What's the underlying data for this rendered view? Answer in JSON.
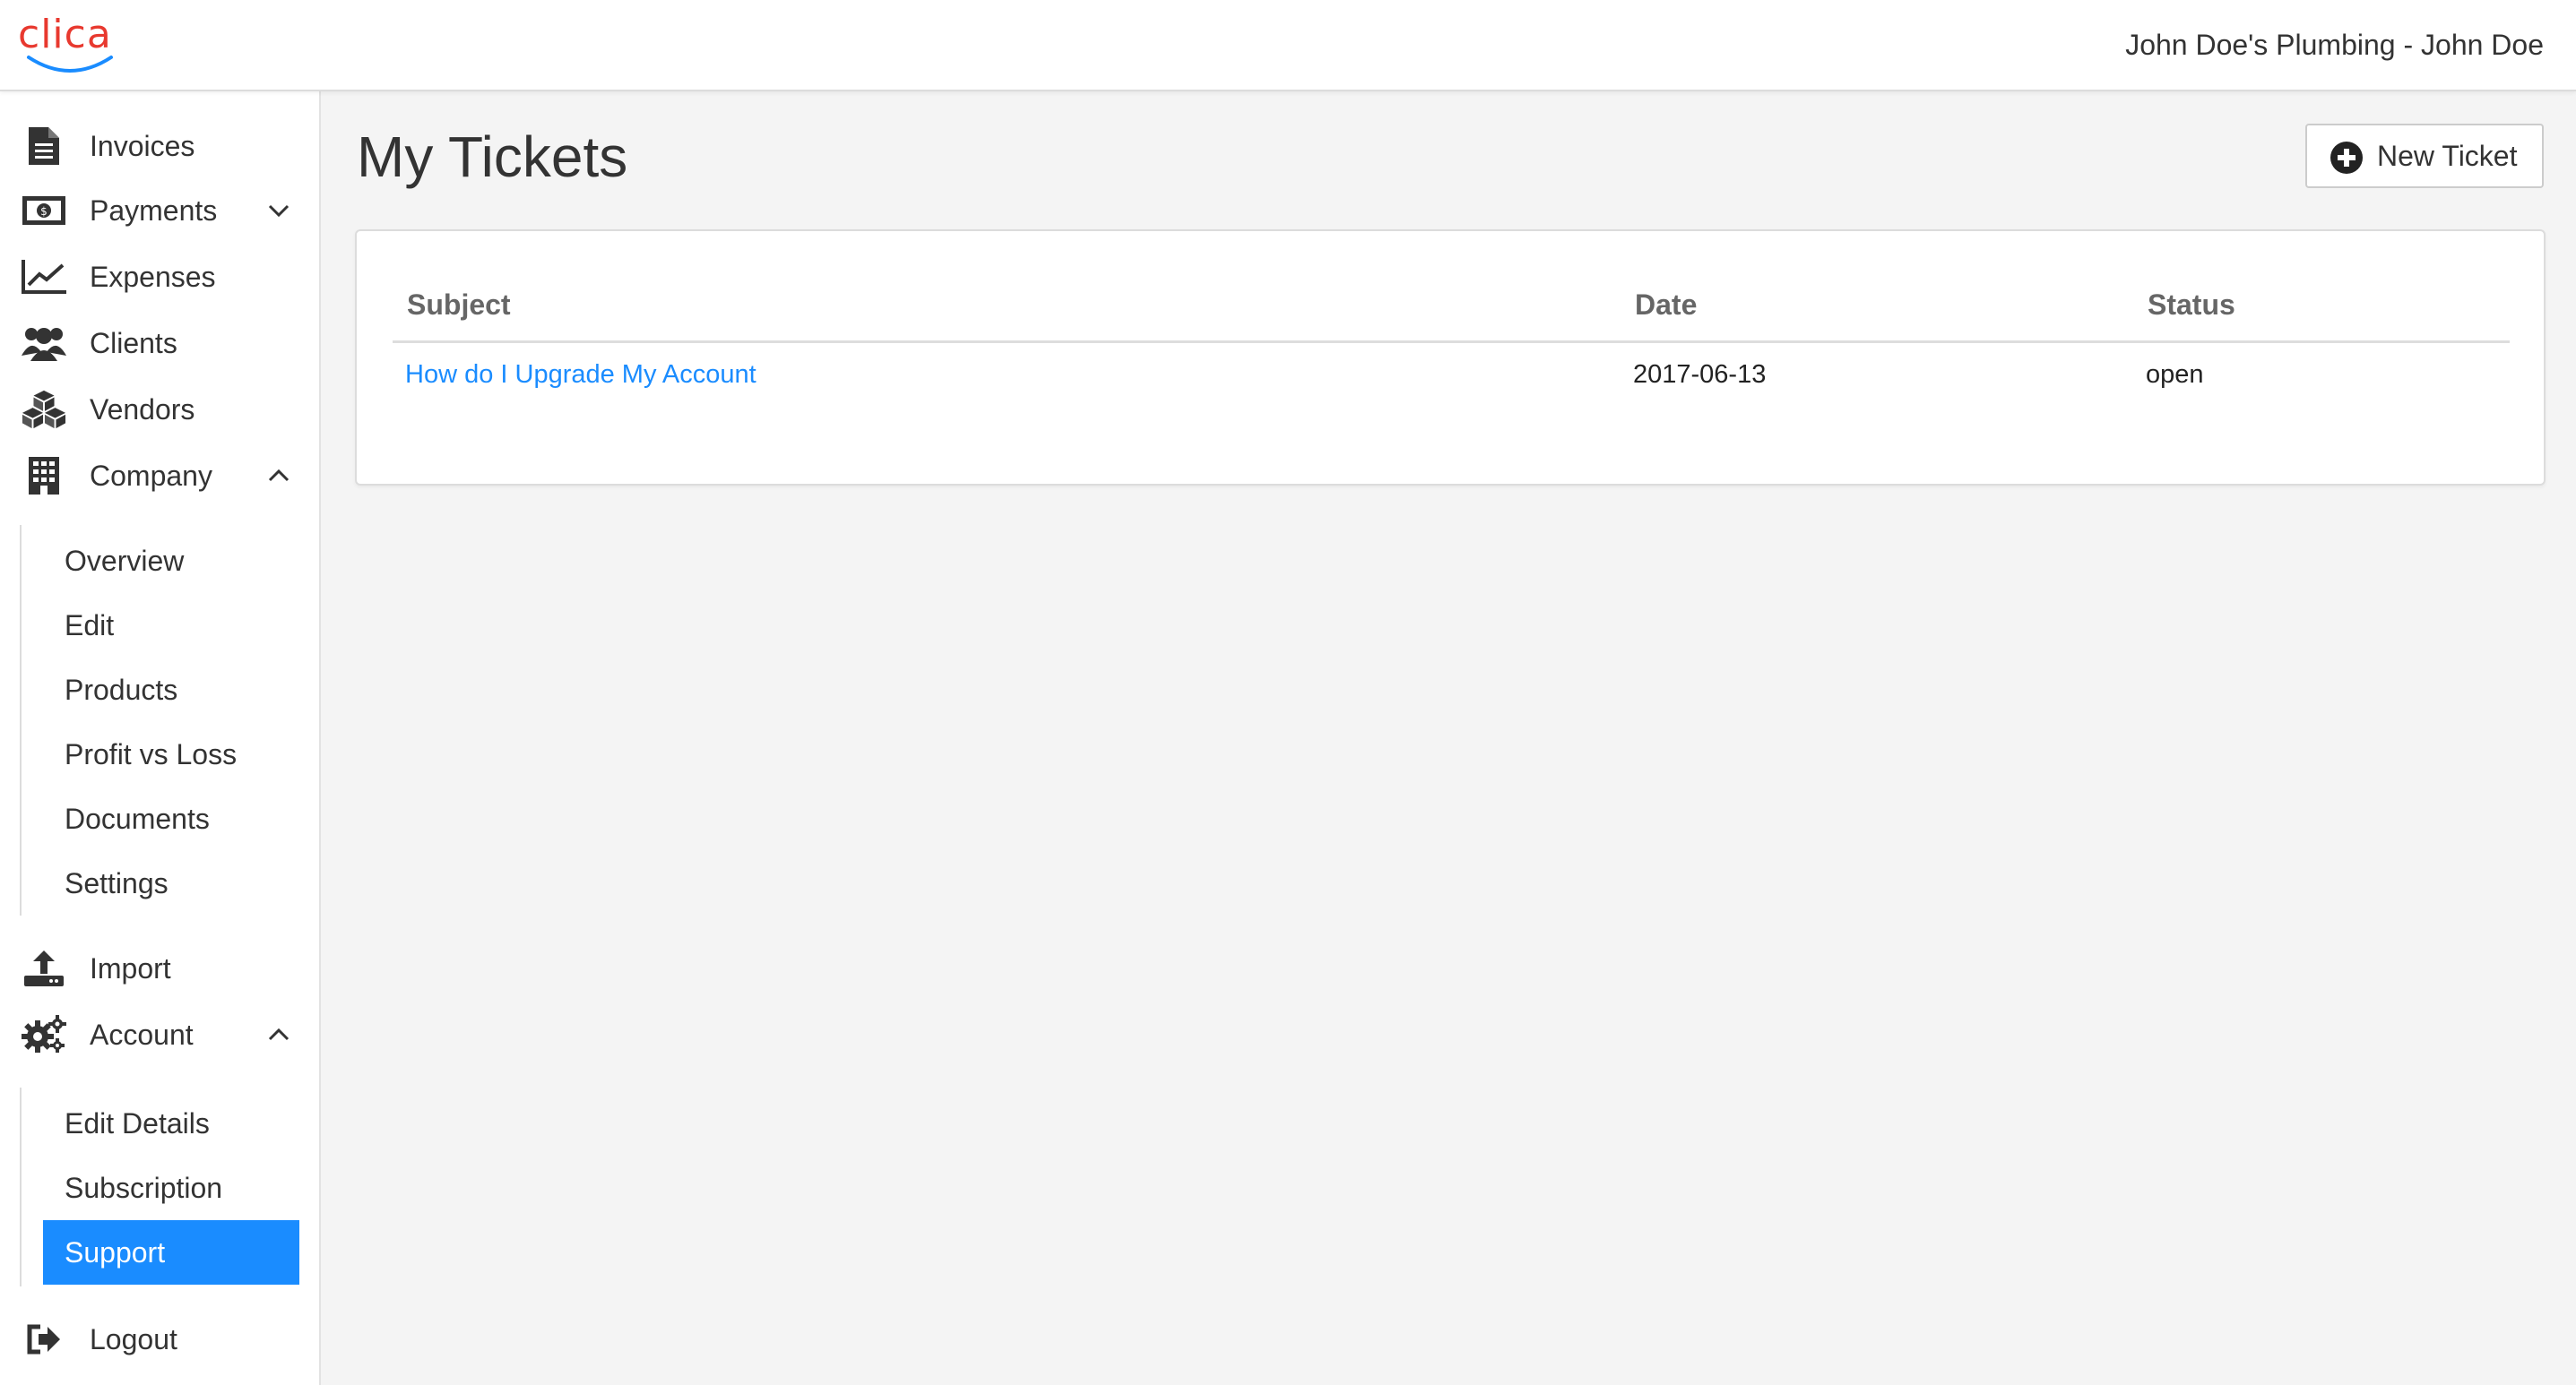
{
  "header": {
    "logo_text": "clica",
    "user_label": "John Doe's Plumbing - John Doe",
    "brand_color": "#e8392f",
    "logo_arc_color": "#1a8cff"
  },
  "sidebar": {
    "items": [
      {
        "label": "Invoices",
        "icon": "document-icon"
      },
      {
        "label": "Payments",
        "icon": "money-icon",
        "expanded": false
      },
      {
        "label": "Expenses",
        "icon": "chart-line-icon"
      },
      {
        "label": "Clients",
        "icon": "users-icon"
      },
      {
        "label": "Vendors",
        "icon": "cubes-icon"
      },
      {
        "label": "Company",
        "icon": "building-icon",
        "expanded": true
      },
      {
        "label": "Import",
        "icon": "upload-icon"
      },
      {
        "label": "Account",
        "icon": "gears-icon",
        "expanded": true
      },
      {
        "label": "Logout",
        "icon": "sign-out-icon"
      }
    ],
    "company_sub": [
      "Overview",
      "Edit",
      "Products",
      "Profit vs Loss",
      "Documents",
      "Settings"
    ],
    "account_sub": [
      "Edit Details",
      "Subscription",
      "Support"
    ],
    "active_item": "Support",
    "active_color": "#1a8cff"
  },
  "main": {
    "title": "My Tickets",
    "new_ticket_label": "New Ticket",
    "table": {
      "columns": [
        "Subject",
        "Date",
        "Status"
      ],
      "rows": [
        {
          "subject": "How do I Upgrade My Account",
          "date": "2017-06-13",
          "status": "open"
        }
      ]
    }
  }
}
